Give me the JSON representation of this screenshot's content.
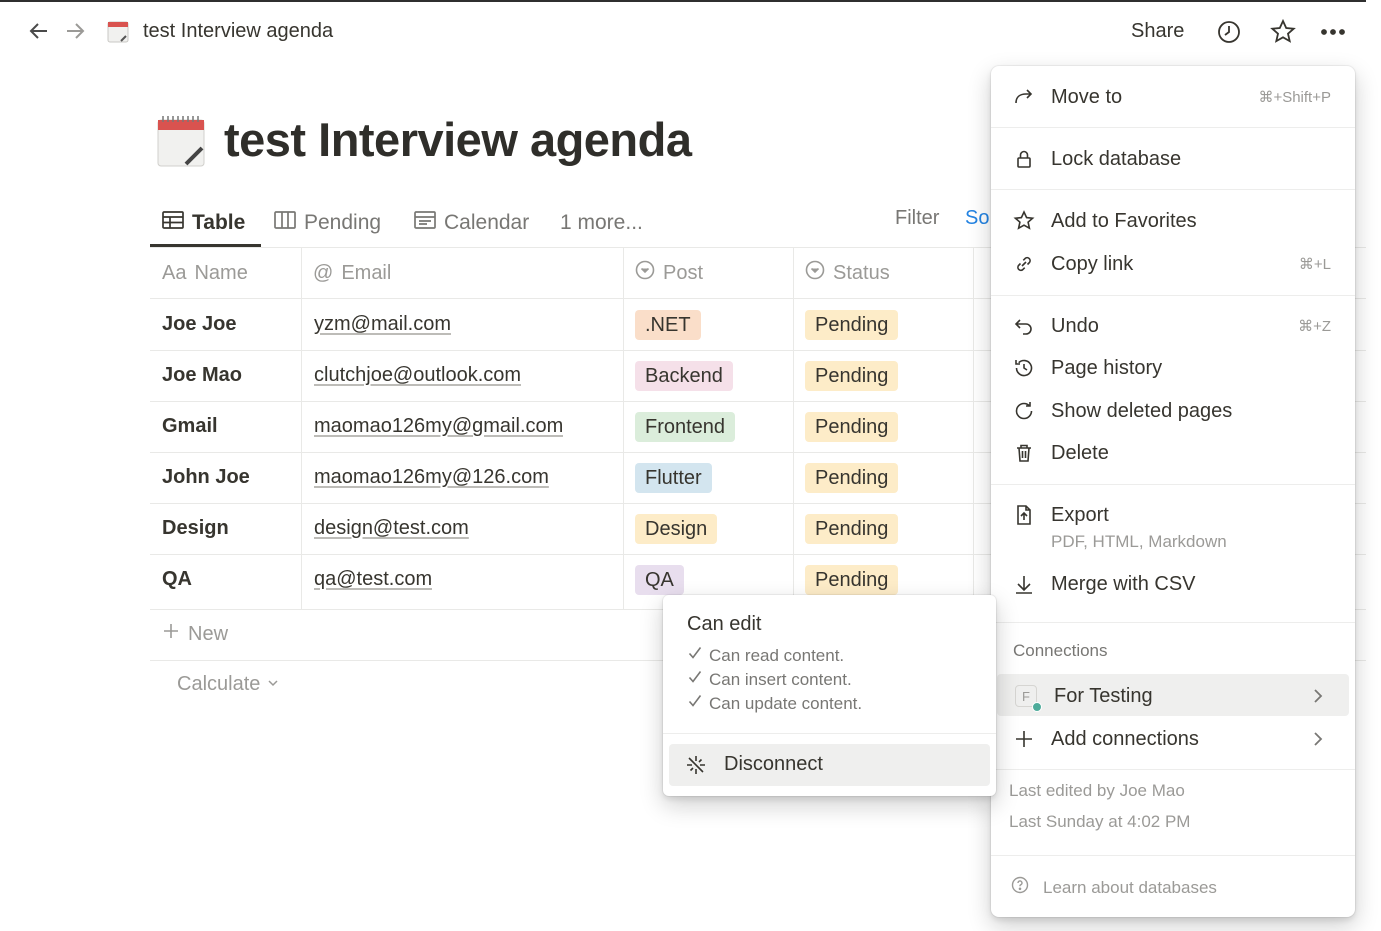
{
  "topbar": {
    "breadcrumb_title": "test Interview agenda",
    "share_label": "Share"
  },
  "page": {
    "title": "test Interview agenda",
    "icon": "calendar-spiral-icon"
  },
  "views": {
    "tabs": [
      {
        "label": "Table",
        "icon": "table-icon",
        "active": true
      },
      {
        "label": "Pending",
        "icon": "board-icon",
        "active": false
      },
      {
        "label": "Calendar",
        "icon": "calendar-icon",
        "active": false
      },
      {
        "label": "1 more...",
        "icon": "",
        "active": false
      }
    ],
    "filter_label": "Filter",
    "sort_label": "So"
  },
  "table": {
    "columns": [
      {
        "label": "Name",
        "icon_text": "Aa"
      },
      {
        "label": "Email",
        "icon_text": "@"
      },
      {
        "label": "Post",
        "icon": "select-icon"
      },
      {
        "label": "Status",
        "icon": "select-icon"
      }
    ],
    "rows": [
      {
        "name": "Joe Joe",
        "email": "yzm@mail.com",
        "post": ".NET",
        "status": "Pending"
      },
      {
        "name": "Joe Mao",
        "email": "clutchjoe@outlook.com",
        "post": "Backend",
        "status": "Pending"
      },
      {
        "name": "Gmail",
        "email": "maomao126my@gmail.com",
        "post": "Frontend",
        "status": "Pending"
      },
      {
        "name": "John Joe",
        "email": "maomao126my@126.com",
        "post": "Flutter",
        "status": "Pending"
      },
      {
        "name": "Design",
        "email": "design@test.com",
        "post": "Design",
        "status": "Pending"
      },
      {
        "name": "QA",
        "email": "qa@test.com",
        "post": "QA",
        "status": "Pending"
      }
    ],
    "new_label": "New",
    "calculate_label": "Calculate"
  },
  "tag_colors": {
    ".NET": "#fadec9",
    "Backend": "#f5e0e9",
    "Frontend": "#dbeddb",
    "Flutter": "#d3e5ef",
    "Design": "#fdecc8",
    "QA": "#e8deee",
    "Pending": "#fdecc8"
  },
  "menu": {
    "move_to": {
      "label": "Move to",
      "shortcut": "⌘+Shift+P"
    },
    "lock": {
      "label": "Lock database"
    },
    "favorites": {
      "label": "Add to Favorites"
    },
    "copy_link": {
      "label": "Copy link",
      "shortcut": "⌘+L"
    },
    "undo": {
      "label": "Undo",
      "shortcut": "⌘+Z"
    },
    "page_history": {
      "label": "Page history"
    },
    "deleted_pages": {
      "label": "Show deleted pages"
    },
    "delete": {
      "label": "Delete"
    },
    "export": {
      "label": "Export",
      "sub": "PDF, HTML, Markdown"
    },
    "merge_csv": {
      "label": "Merge with CSV"
    },
    "connections_heading": "Connections",
    "for_testing": {
      "label": "For Testing",
      "badge": "F"
    },
    "add_connections": {
      "label": "Add connections"
    },
    "last_edited_by": "Last edited by Joe Mao",
    "last_edited_at": "Last Sunday at 4:02 PM",
    "learn": "Learn about databases"
  },
  "popup": {
    "title": "Can edit",
    "permissions": [
      "Can read content.",
      "Can insert content.",
      "Can update content."
    ],
    "disconnect_label": "Disconnect"
  }
}
